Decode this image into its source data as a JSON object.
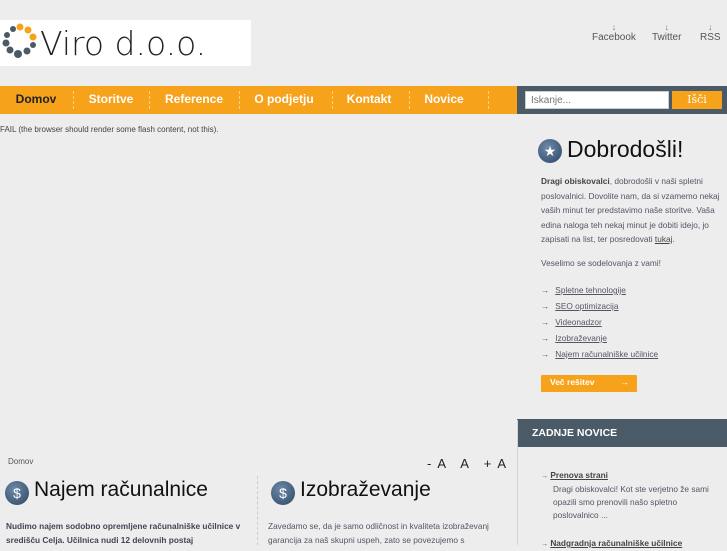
{
  "header": {
    "logo_text": "Viro d.o.o.",
    "social": [
      {
        "label": "Facebook"
      },
      {
        "label": "Twitter"
      },
      {
        "label": "RSS"
      }
    ],
    "social_arrow": "↓"
  },
  "nav": {
    "items": [
      {
        "label": "Domov"
      },
      {
        "label": "Storitve"
      },
      {
        "label": "Reference"
      },
      {
        "label": "O podjetju"
      },
      {
        "label": "Kontakt"
      },
      {
        "label": "Novice"
      }
    ]
  },
  "search": {
    "placeholder": "Iskanje...",
    "button": "Išči"
  },
  "main": {
    "fail_text": "FAIL (the browser should render some flash content, not this).",
    "breadcrumb": "Domov",
    "font_controls": [
      "-A",
      "A",
      "+A"
    ],
    "columns": [
      {
        "title": "Najem računalnice",
        "text": "Nudimo najem sodobno opremljene računalniške učilnice v središču Celja. Učilnica nudi 12 delovnih postaj"
      },
      {
        "title": "Izobraževanje",
        "text": "Zavedamo se, da je samo odličnost in kvaliteta izobraževanj garancija za naš skupni uspeh, zato se povezujemo s"
      }
    ]
  },
  "welcome": {
    "title": "Dobrodošli!",
    "bold": "Dragi obiskovalci",
    "body": ", dobrodošli v naši spletni poslovalnici. Dovolite nam, da si vzamemo nekaj vaših minut ter predstavimo naše storitve. Vaša edina naloga teh nekaj minut je dobiti idejo, jo zapisati na list, ter posredovati ",
    "link": "tukaj",
    "end": ".",
    "closing": "Veselimo se sodelovanja z vami!",
    "solutions": [
      "Spletne tehnologije",
      "SEO optimizacija",
      "Videonadzor",
      "Izobraževanje",
      "Najem računalniške učilnice"
    ],
    "more_button": "Več rešitev",
    "arrow": "→"
  },
  "news": {
    "heading": "ZADNJE NOVICE",
    "items": [
      {
        "title": "Prenova strani",
        "text": "Dragi obiskovalci! Kot ste verjetno že sami opazili smo prenovili našo spletno poslovalnico ..."
      },
      {
        "title": "Nadgradnja računalniške učilnice",
        "text": ""
      }
    ]
  }
}
